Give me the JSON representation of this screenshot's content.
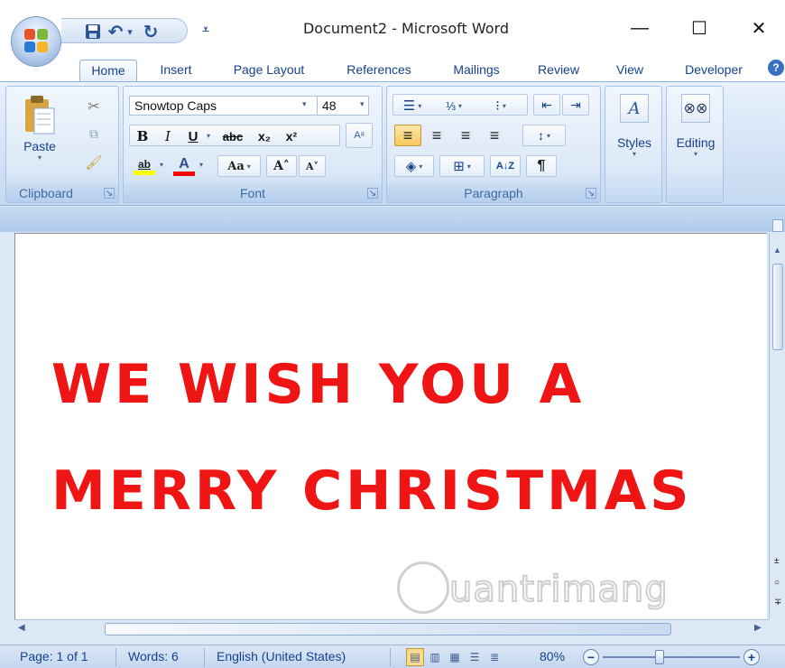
{
  "window": {
    "title": "Document2 - Microsoft Word",
    "minimize": "—",
    "maximize": "☐",
    "close": "✕"
  },
  "qat": {
    "save": "💾",
    "undo": "↶",
    "undo_dropdown": "▾",
    "redo": "↻",
    "customize": "⩡"
  },
  "tabs": [
    "Home",
    "Insert",
    "Page Layout",
    "References",
    "Mailings",
    "Review",
    "View",
    "Developer"
  ],
  "active_tab": "Home",
  "ribbon": {
    "clipboard": {
      "label": "Clipboard",
      "paste": "Paste",
      "cut_icon": "✂",
      "copy_icon": "⧉",
      "format_painter_icon": "🖌"
    },
    "font": {
      "label": "Font",
      "font_name": "Snowtop Caps",
      "font_size": "48",
      "bold": "B",
      "italic": "I",
      "underline": "U",
      "strikethrough": "abc",
      "subscript": "x₂",
      "superscript": "x²",
      "clear_format": "Aᵃ",
      "highlight": "ab",
      "font_color": "A",
      "change_case": "Aa",
      "grow_font": "A˄",
      "shrink_font": "A˅",
      "highlight_color": "#ffff00",
      "font_color_value": "#ff0000"
    },
    "paragraph": {
      "label": "Paragraph",
      "bullets": "☰",
      "numbering": "⅓",
      "multilevel": "⁝",
      "decrease_indent": "⇤",
      "increase_indent": "⇥",
      "align_left": "≡",
      "center": "≡",
      "align_right": "≡",
      "justify": "≡",
      "line_spacing": "↕",
      "shading": "◈",
      "borders": "⊞",
      "sort": "A↓Z",
      "show_marks": "¶"
    },
    "styles": {
      "label": "Styles"
    },
    "editing": {
      "label": "Editing"
    }
  },
  "document": {
    "line1": "WE WISH YOU A",
    "line2": "MERRY CHRISTMAS",
    "text_color": "#f01515"
  },
  "watermark": {
    "text": "uantrimang"
  },
  "statusbar": {
    "page": "Page: 1 of 1",
    "words": "Words: 6",
    "language": "English (United States)",
    "zoom": "80%",
    "zoom_out": "−",
    "zoom_in": "+"
  },
  "colors": {
    "ribbon_bg": "#dde9f7",
    "accent": "#15428b",
    "selected": "#f9c65c"
  }
}
